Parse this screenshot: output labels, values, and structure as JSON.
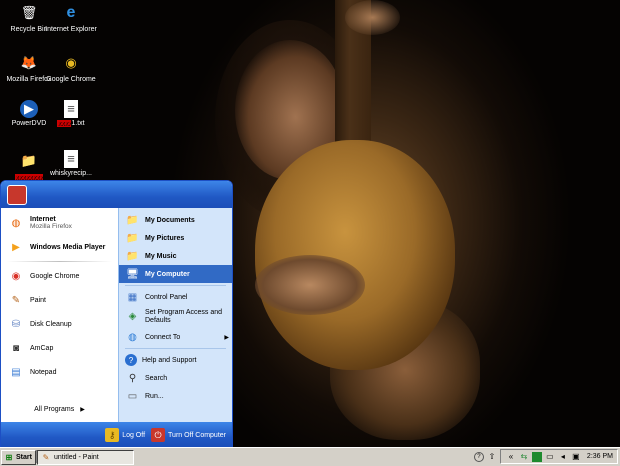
{
  "desktop": {
    "icons": [
      {
        "label": "Recycle Bin",
        "icon": "recycle-bin-icon",
        "glyph": "🗑"
      },
      {
        "label": "Internet Explorer",
        "icon": "internet-explorer-icon",
        "glyph": "e"
      },
      {
        "label": "Mozilla Firefox",
        "icon": "firefox-icon",
        "glyph": "🦊"
      },
      {
        "label": "Google Chrome",
        "icon": "chrome-icon",
        "glyph": "◉"
      },
      {
        "label": "PowerDVD",
        "icon": "powerdvd-icon",
        "glyph": "▶"
      },
      {
        "label": "1.txt",
        "icon": "text-file-icon",
        "glyph": "≡"
      },
      {
        "label": "",
        "icon": "folder-icon",
        "glyph": "📁"
      },
      {
        "label": "whiskyrecip...",
        "icon": "document-icon",
        "glyph": "≡"
      }
    ]
  },
  "start_menu": {
    "user_name": "",
    "pinned": [
      {
        "title": "Internet",
        "subtitle": "Mozilla Firefox",
        "icon": "firefox-icon",
        "glyph": "◍",
        "color": "#e66000"
      },
      {
        "title": "Windows Media Player",
        "subtitle": "",
        "icon": "media-player-icon",
        "glyph": "▶",
        "color": "#f4a11c"
      }
    ],
    "recent": [
      {
        "label": "Google Chrome",
        "icon": "chrome-icon",
        "glyph": "◉",
        "color": "#d93025"
      },
      {
        "label": "Paint",
        "icon": "paint-icon",
        "glyph": "✎",
        "color": "#b5651d"
      },
      {
        "label": "Disk Cleanup",
        "icon": "disk-cleanup-icon",
        "glyph": "⛁",
        "color": "#5a7dbf"
      },
      {
        "label": "AmCap",
        "icon": "amcap-icon",
        "glyph": "◙",
        "color": "#333333"
      },
      {
        "label": "Notepad",
        "icon": "notepad-icon",
        "glyph": "▤",
        "color": "#3a7bd5"
      }
    ],
    "all_programs": "All Programs",
    "right_group1": [
      {
        "label": "My Documents",
        "icon": "my-documents-icon",
        "glyph": "📁",
        "selected": false
      },
      {
        "label": "My Pictures",
        "icon": "my-pictures-icon",
        "glyph": "📁",
        "selected": false
      },
      {
        "label": "My Music",
        "icon": "my-music-icon",
        "glyph": "📁",
        "selected": false
      },
      {
        "label": "My Computer",
        "icon": "my-computer-icon",
        "glyph": "🖥",
        "selected": true
      }
    ],
    "right_group2": [
      {
        "label": "Control Panel",
        "icon": "control-panel-icon",
        "glyph": "▦",
        "arrow": false
      },
      {
        "label": "Set Program Access and Defaults",
        "icon": "program-access-icon",
        "glyph": "◈",
        "arrow": false
      },
      {
        "label": "Connect To",
        "icon": "connect-to-icon",
        "glyph": "◍",
        "arrow": true
      }
    ],
    "right_group3": [
      {
        "label": "Help and Support",
        "icon": "help-icon",
        "glyph": "?"
      },
      {
        "label": "Search",
        "icon": "search-icon",
        "glyph": "⚲"
      },
      {
        "label": "Run...",
        "icon": "run-icon",
        "glyph": "▭"
      }
    ],
    "log_off": "Log Off",
    "turn_off": "Turn Off Computer"
  },
  "taskbar": {
    "start_label": "Start",
    "task_label": "untitled - Paint",
    "clock": "2:36 PM"
  },
  "colors": {
    "start_header": "#2058c4",
    "selection": "#316ac5",
    "right_pane": "#d3e5fa",
    "taskbar": "#d4d0c8"
  }
}
